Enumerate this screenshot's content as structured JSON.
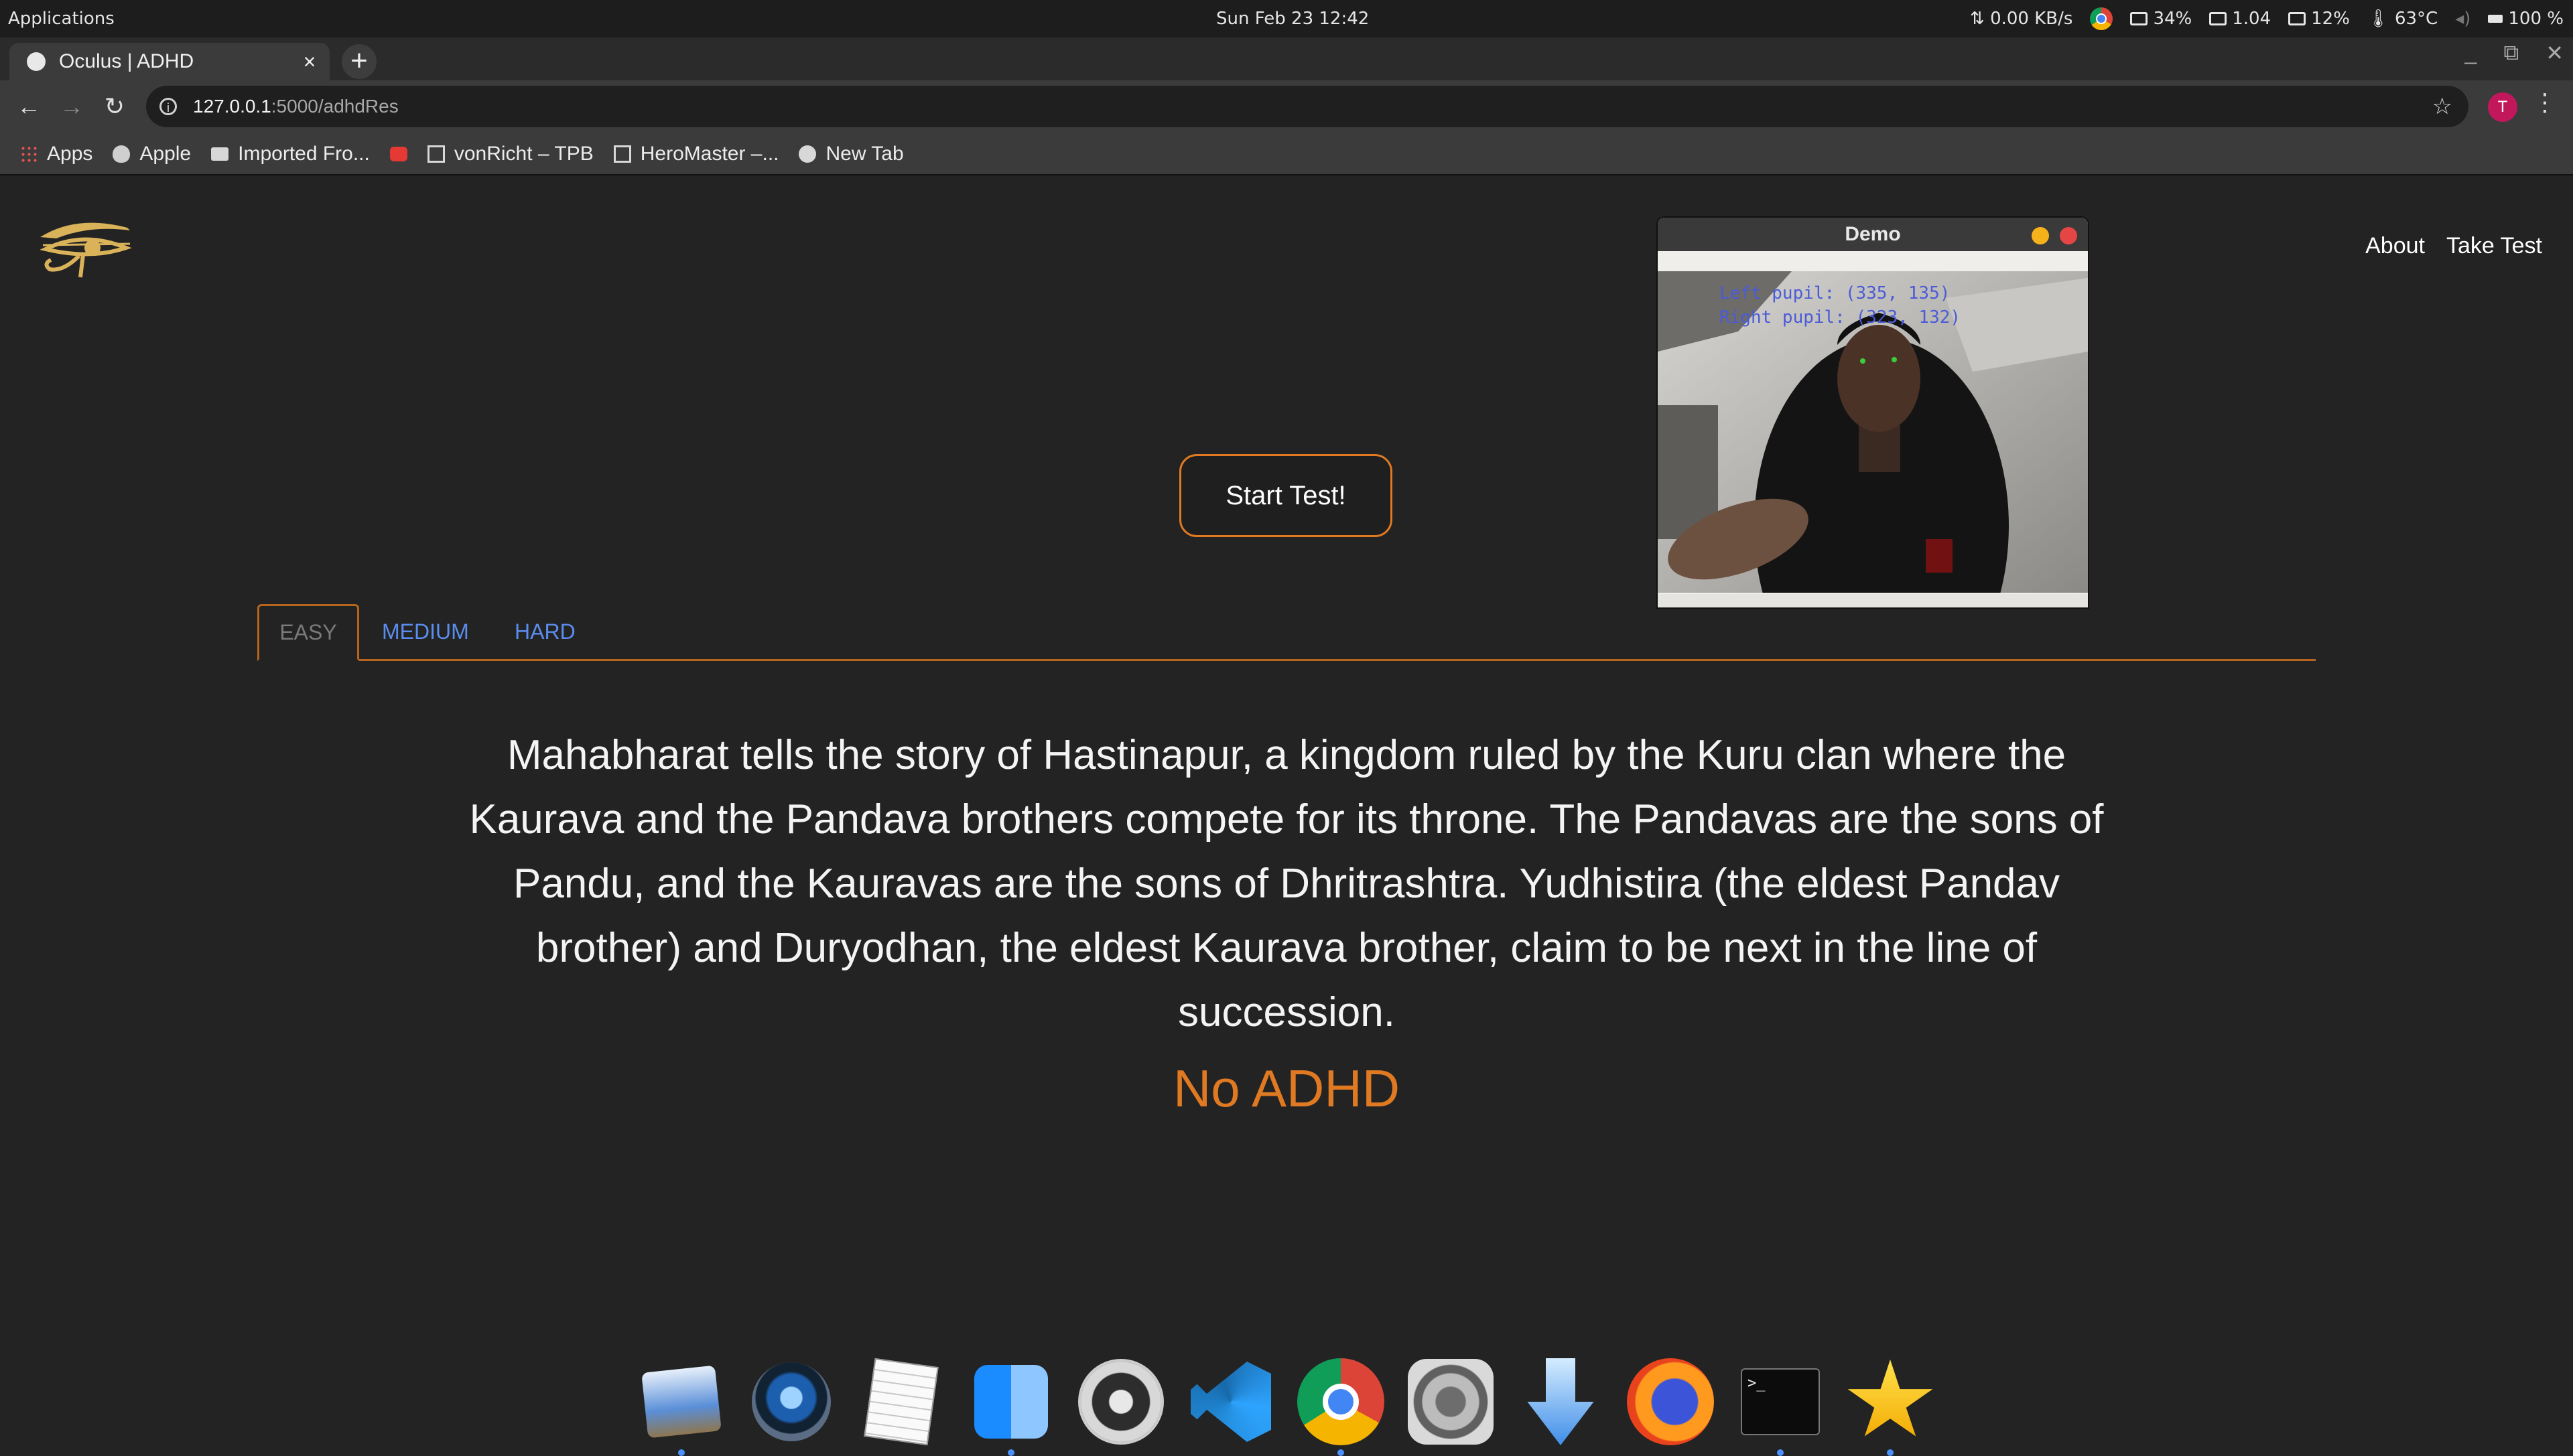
{
  "os_bar": {
    "apps_menu": "Applications",
    "clock": "Sun Feb 23  12:42",
    "net": "⇅ 0.00 KB/s",
    "mem": "34%",
    "load": "1.04",
    "cpu": "12%",
    "temp": "63°C",
    "battery": "100 %"
  },
  "browser": {
    "tab_title": "Oculus | ADHD",
    "tab_close": "×",
    "new_tab": "+",
    "url_host": "127.0.0.1",
    "url_path": ":5000/adhdRes",
    "profile_initial": "T",
    "bookmarks": [
      {
        "label": "Apps",
        "icon": "apps-grid-icon"
      },
      {
        "label": "Apple",
        "icon": "apple-icon"
      },
      {
        "label": "Imported Fro...",
        "icon": "folder-icon"
      },
      {
        "label": "",
        "icon": "youtube-icon"
      },
      {
        "label": "vonRicht – TPB",
        "icon": "page-icon"
      },
      {
        "label": "HeroMaster –...",
        "icon": "page-icon"
      },
      {
        "label": "New Tab",
        "icon": "globe-icon"
      }
    ]
  },
  "page": {
    "nav": {
      "about": "About",
      "take_test": "Take Test"
    },
    "start_button": "Start Test!",
    "tabs": {
      "easy": "EASY",
      "medium": "MEDIUM",
      "hard": "HARD",
      "active": "EASY"
    },
    "passage": "Mahabharat tells the story of Hastinapur, a kingdom ruled by the Kuru clan where the Kaurava and the Pandava brothers compete for its throne. The Pandavas are the sons of Pandu, and the Kauravas are the sons of Dhritrashtra. Yudhistira (the eldest Pandav brother) and Duryodhan, the eldest Kaurava brother, claim to be next in the line of succession.",
    "result": "No ADHD",
    "accent_color": "#e07a22",
    "link_color": "#5b8def"
  },
  "demo_window": {
    "title": "Demo",
    "left_pupil": "Left pupil:  (335, 135)",
    "right_pupil": "Right pupil: (323, 132)"
  },
  "dock": {
    "items": [
      "photos-icon",
      "quicktime-icon",
      "textedit-icon",
      "finder-icon",
      "settings-gear-icon",
      "vscode-icon",
      "chrome-icon",
      "system-preferences-icon",
      "downloads-icon",
      "firefox-icon",
      "terminal-icon",
      "favorites-star-icon"
    ],
    "terminal_prompt": ">_"
  }
}
